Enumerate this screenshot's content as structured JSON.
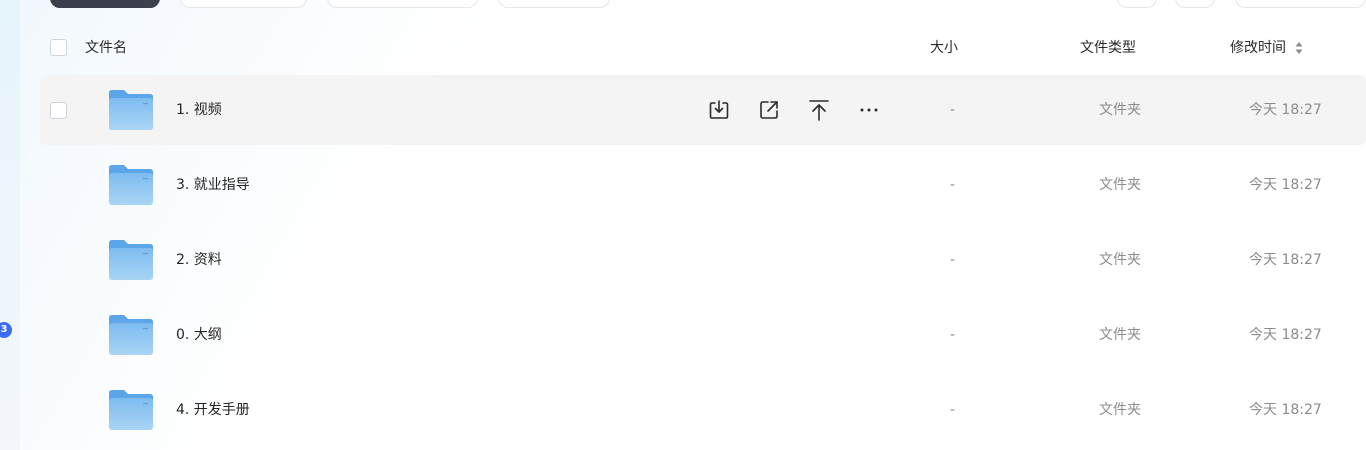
{
  "table": {
    "headers": {
      "name": "文件名",
      "size": "大小",
      "type": "文件类型",
      "modified": "修改时间"
    },
    "rows": [
      {
        "name": "1. 视频",
        "size": "-",
        "type": "文件夹",
        "modified": "今天 18:27"
      },
      {
        "name": "3. 就业指导",
        "size": "-",
        "type": "文件夹",
        "modified": "今天 18:27"
      },
      {
        "name": "2. 资料",
        "size": "-",
        "type": "文件夹",
        "modified": "今天 18:27"
      },
      {
        "name": "0. 大纲",
        "size": "-",
        "type": "文件夹",
        "modified": "今天 18:27"
      },
      {
        "name": "4. 开发手册",
        "size": "-",
        "type": "文件夹",
        "modified": "今天 18:27"
      }
    ]
  },
  "sidebar": {
    "badge": "3"
  },
  "icons": {
    "folder": "folder-icon",
    "download": "download-icon",
    "share": "share-icon",
    "move_top": "move-to-top-icon",
    "more": "more-icon",
    "sort": "sort-icon"
  },
  "colors": {
    "folder": "#7fbdf0",
    "badge": "#3a6cf6",
    "hover_row": "#f4f4f4",
    "muted_text": "#8c8c8c"
  }
}
